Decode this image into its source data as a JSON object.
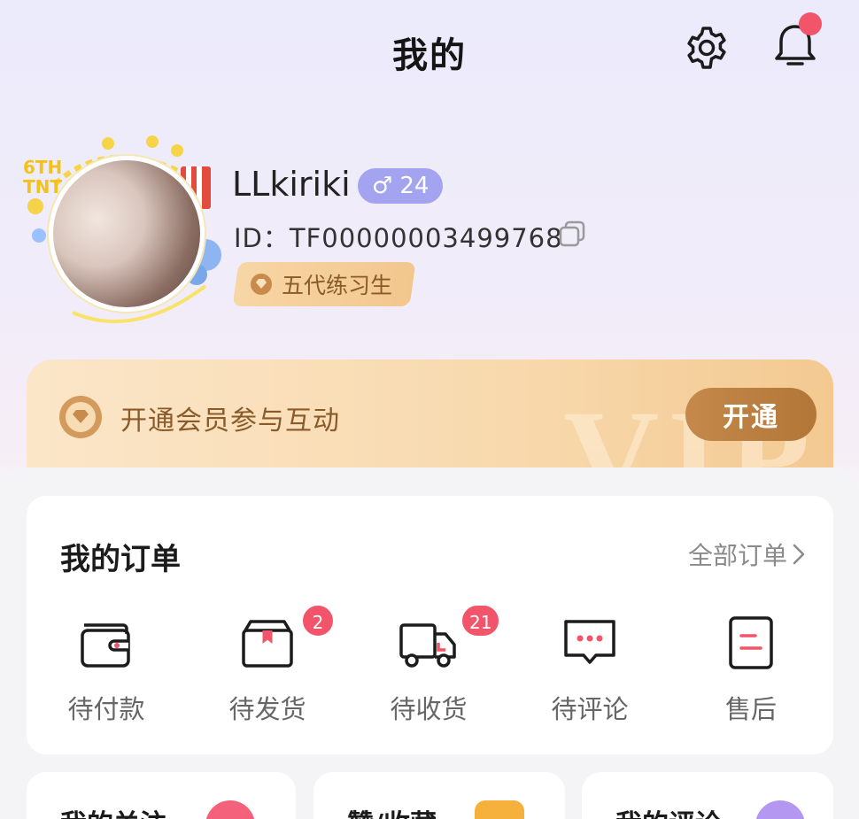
{
  "header": {
    "title": "我的",
    "notification_dot": true
  },
  "profile": {
    "username": "LLkiriki",
    "gender_symbol": "♂",
    "age": "24",
    "user_id": "ID：TF00000003499768",
    "level": "五代练习生",
    "avatar_frame_text": "6TH TNT"
  },
  "vip": {
    "text": "开通会员参与互动",
    "button": "开通",
    "watermark": "VIP"
  },
  "orders": {
    "title": "我的订单",
    "all_link": "全部订单",
    "items": [
      {
        "label": "待付款",
        "icon": "wallet-icon",
        "badge": ""
      },
      {
        "label": "待发货",
        "icon": "package-icon",
        "badge": "2"
      },
      {
        "label": "待收货",
        "icon": "truck-icon",
        "badge": "21"
      },
      {
        "label": "待评论",
        "icon": "comment-icon",
        "badge": ""
      },
      {
        "label": "售后",
        "icon": "after-sales-icon",
        "badge": ""
      }
    ]
  },
  "cards": [
    {
      "title": "我的关注",
      "icon": "heart-icon"
    },
    {
      "title": "赞/收藏",
      "icon": "thumbs-up-icon"
    },
    {
      "title": "我的评论",
      "icon": "comment-bubble-icon"
    }
  ],
  "colors": {
    "accent_red": "#f2546a",
    "gender_badge": "#a4a3ef",
    "vip_gold": "#b27737",
    "vip_text": "#8a5a28"
  }
}
